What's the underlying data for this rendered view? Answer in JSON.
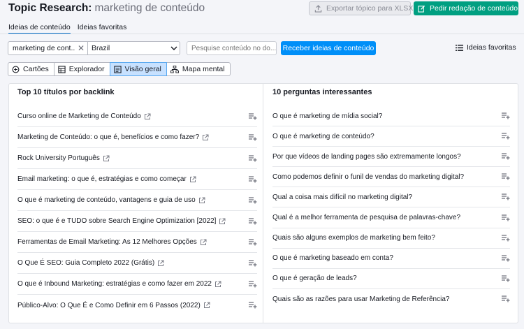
{
  "header": {
    "title": "Topic Research:",
    "keyword": "marketing de conteúdo",
    "export_label": "Exportar tópico para XLSX",
    "request_label": "Pedir redação de conteúdo"
  },
  "tabs": [
    {
      "label": "Ideias de conteúdo",
      "active": true
    },
    {
      "label": "Ideias favoritas",
      "active": false
    }
  ],
  "search": {
    "keyword_value": "marketing de cont...",
    "country_value": "Brazil",
    "filter_placeholder": "Pesquise conteúdo no do...",
    "get_ideas_label": "Receber ideias de conteúdo",
    "favorites_label": "Ideias favoritas"
  },
  "views": [
    {
      "label": "Cartões",
      "icon": "cards-icon",
      "active": false
    },
    {
      "label": "Explorador",
      "icon": "table-icon",
      "active": false
    },
    {
      "label": "Visão geral",
      "icon": "overview-icon",
      "active": true
    },
    {
      "label": "Mapa mental",
      "icon": "mind-map-icon",
      "active": false
    }
  ],
  "left_panel": {
    "title": "Top 10 títulos por backlink",
    "items": [
      "Curso online de Marketing de Conteúdo",
      "Marketing de Conteúdo: o que é, benefícios e como fazer?",
      "Rock University Português",
      "Email marketing: o que é, estratégias e como começar",
      "O que é marketing de conteúdo, vantagens e guia de uso",
      "SEO: o que é e TUDO sobre Search Engine Optimization [2022]",
      "Ferramentas de Email Marketing: As 12 Melhores Opções",
      "O Que É SEO: Guia Completo 2022 (Grátis)",
      "O que é Inbound Marketing: estratégias e como fazer em 2022",
      "Público-Alvo: O Que É e Como Definir em 6 Passos (2022)"
    ]
  },
  "right_panel": {
    "title": "10 perguntas interessantes",
    "items": [
      "O que é marketing de mídia social?",
      "O que é marketing de conteúdo?",
      "Por que vídeos de landing pages são extremamente longos?",
      "Como podemos definir o funil de vendas do marketing digital?",
      "Qual a coisa mais difícil no marketing digital?",
      "Qual é a melhor ferramenta de pesquisa de palavras-chave?",
      "Quais são alguns exemplos de marketing bem feito?",
      "O que é marketing baseado em conta?",
      "O que é geração de leads?",
      "Quais são as razões para usar Marketing de Referência?"
    ]
  },
  "colors": {
    "accent_green": "#009f81",
    "accent_blue": "#008ff8",
    "active_tab_underline": "#006dca",
    "active_view_bg": "#c7e1ff"
  }
}
